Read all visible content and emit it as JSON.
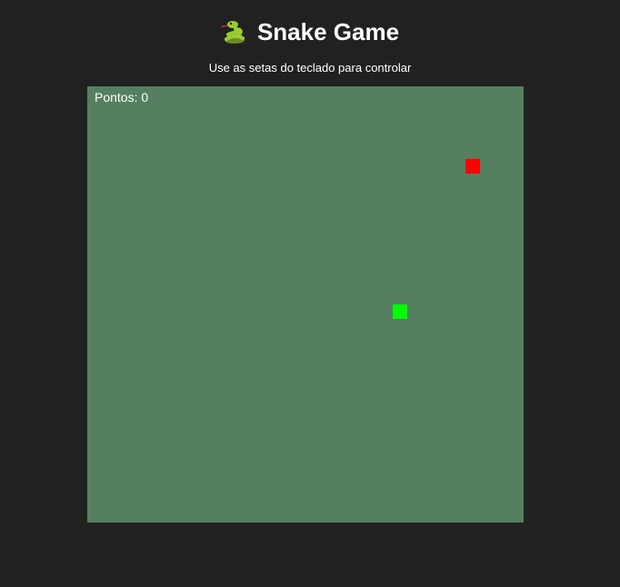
{
  "header": {
    "title": "Snake Game",
    "icon": "snake-icon"
  },
  "instructions": "Use as setas do teclado para controlar",
  "score": {
    "text": "Pontos: 0",
    "value": 0
  },
  "game": {
    "grid_columns": 30,
    "grid_rows": 30,
    "food": {
      "col": 26,
      "row": 5
    },
    "snake": [
      {
        "col": 21,
        "row": 15
      }
    ]
  },
  "colors": {
    "background": "#212121",
    "board": "#548060",
    "food": "#ff0000",
    "snake": "#00ff00",
    "text": "#ffffff"
  }
}
